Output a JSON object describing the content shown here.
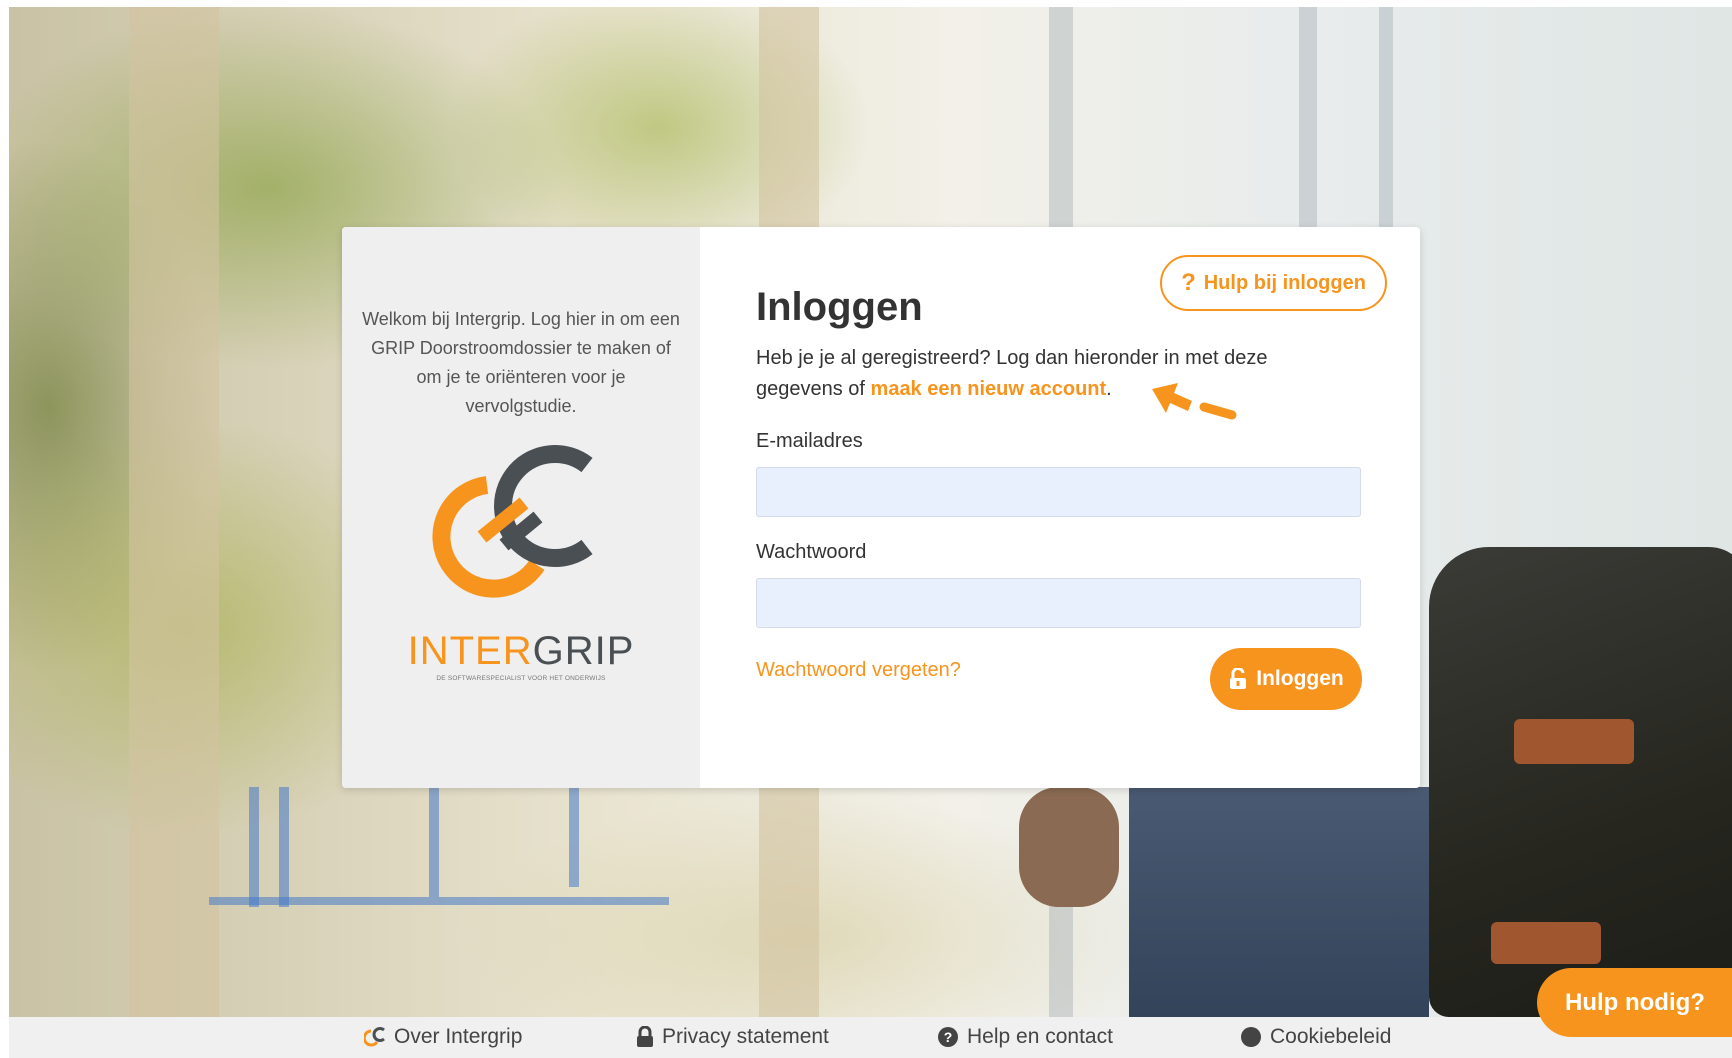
{
  "card": {
    "welcome_text": "Welkom bij Intergrip. Log hier in om een GRIP Doorstroomdossier te maken of om je te oriënteren voor je vervolgstudie.",
    "logo": {
      "brand_inter": "INTER",
      "brand_grip": "GRIP",
      "tagline": "DE SOFTWARESPECIALIST VOOR HET ONDERWIJS"
    },
    "help_button": {
      "icon": "?",
      "label": "Hulp bij inloggen"
    },
    "title": "Inloggen",
    "intro_prefix": "Heb je je al geregistreerd? Log dan hieronder in met deze gegevens of ",
    "intro_link": "maak een nieuw account",
    "intro_suffix": ".",
    "email_label": "E-mailadres",
    "email_value": "",
    "password_label": "Wachtwoord",
    "password_value": "",
    "forgot_link": "Wachtwoord vergeten?",
    "login_button": "Inloggen"
  },
  "footer": {
    "items": [
      {
        "label": "Over Intergrip",
        "icon": "intergrip-logo-icon"
      },
      {
        "label": "Privacy statement",
        "icon": "lock-icon"
      },
      {
        "label": "Help en contact",
        "icon": "question-circle-icon"
      },
      {
        "label": "Cookiebeleid",
        "icon": "circle-icon"
      }
    ]
  },
  "help_widget": {
    "label": "Hulp nodig?"
  },
  "colors": {
    "accent": "#f7941d",
    "logo_dark": "#4a4f54",
    "input_bg": "#e8f0fe",
    "panel_gray": "#efefef"
  }
}
